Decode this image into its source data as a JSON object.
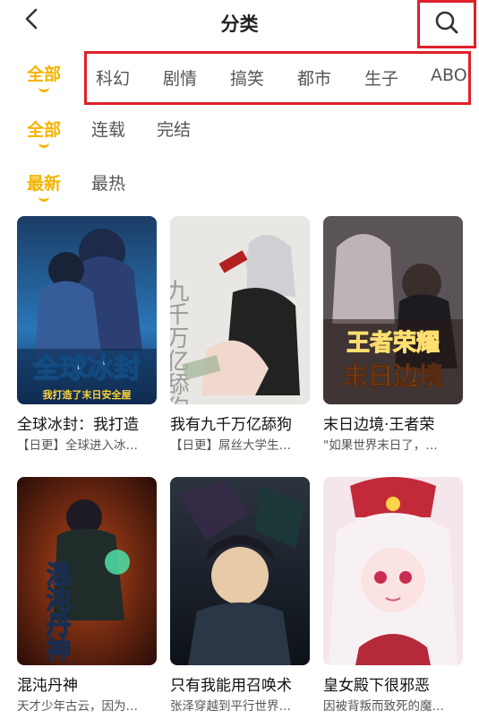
{
  "header": {
    "title": "分类",
    "back_icon": "chevron-left-icon",
    "search_icon": "search-icon"
  },
  "filters": {
    "genre": {
      "all": "全部",
      "items": [
        "科幻",
        "剧情",
        "搞笑",
        "都市",
        "生子",
        "ABO"
      ]
    },
    "status": {
      "all": "全部",
      "items": [
        "连载",
        "完结"
      ]
    },
    "sort": {
      "selected": "最新",
      "items": [
        "最热"
      ]
    }
  },
  "colors": {
    "accent": "#f3b400",
    "highlight_box": "#e0202a"
  },
  "comics": [
    {
      "title": "全球冰封：我打造",
      "desc": "【日更】全球进入冰…",
      "cover_text": "全球冰封",
      "cover_sub": "我打造了末日安全屋"
    },
    {
      "title": "我有九千万亿舔狗",
      "desc": "【日更】屌丝大学生…",
      "cover_text": "九千万亿舔狗金"
    },
    {
      "title": "末日边境·王者荣",
      "desc": "\"如果世界末日了，…",
      "cover_text": "王者荣耀",
      "cover_sub": "末日边境"
    },
    {
      "title": "混沌丹神",
      "desc": "天才少年古云，因为…",
      "cover_text": "混沌丹神"
    },
    {
      "title": "只有我能用召唤术",
      "desc": "张泽穿越到平行世界…"
    },
    {
      "title": "皇女殿下很邪恶",
      "desc": "因被背叛而致死的魔…"
    }
  ]
}
